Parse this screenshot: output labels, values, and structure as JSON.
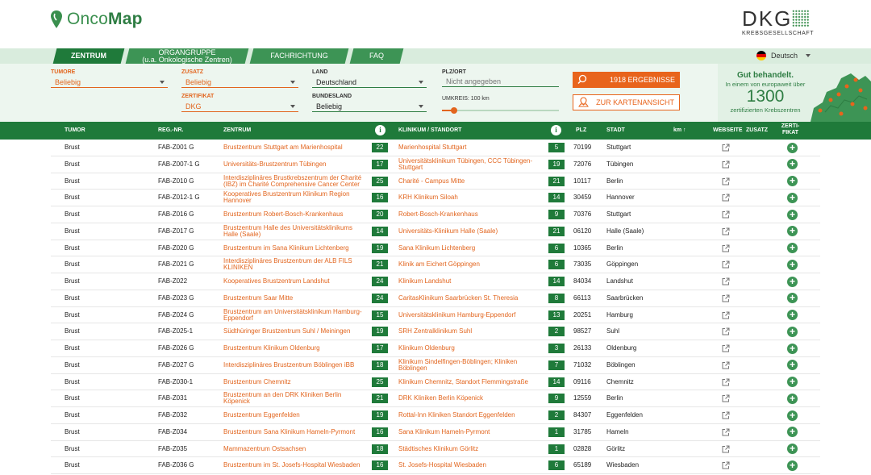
{
  "brand": {
    "logo_prefix": "Onco",
    "logo_suffix": "Map",
    "partner_word": "DKG",
    "partner_sub": "KREBSGESELLSCHAFT"
  },
  "tabs": [
    {
      "label": "ZENTRUM",
      "active": true
    },
    {
      "label_line1": "ORGANGRUPPE",
      "label_line2": "(u.a. Onkologische Zentren)"
    },
    {
      "label": "FACHRICHTUNG"
    },
    {
      "label": "FAQ"
    }
  ],
  "language": "Deutsch",
  "filters": {
    "tumore": {
      "label": "TUMORE",
      "value": "Beliebig"
    },
    "zusatz": {
      "label": "ZUSATZ",
      "value": "Beliebig"
    },
    "zertifikat": {
      "label": "ZERTIFIKAT",
      "value": "DKG"
    },
    "land": {
      "label": "LAND",
      "value": "Deutschland"
    },
    "bundesland": {
      "label": "BUNDESLAND",
      "value": "Beliebig"
    },
    "plz": {
      "label": "PLZ/ORT",
      "placeholder": "Nicht angegeben"
    },
    "umkreis": {
      "label": "UMKREIS: 100 km",
      "fraction": 0.1
    }
  },
  "buttons": {
    "results": "1918 ERGEBNISSE",
    "map": "ZUR KARTENANSICHT"
  },
  "promo": {
    "line1": "Gut behandelt.",
    "line2": "In einem von europaweit über",
    "number": "1300",
    "line3": "zertifizierten Krebszentren"
  },
  "table": {
    "headers": {
      "tumor": "TUMOR",
      "reg": "REG.-NR.",
      "zentrum": "ZENTRUM",
      "klinikum": "KLINIKUM / STANDORT",
      "plz": "PLZ",
      "stadt": "STADT",
      "km": "km ↑",
      "webseite": "WEBSEITE",
      "zusatz": "ZUSATZ",
      "zerti1": "ZERTI-",
      "zerti2": "FIKAT",
      "info": "i"
    },
    "rows": [
      {
        "tumor": "Brust",
        "reg": "FAB-Z001 G",
        "zentrum": "Brustzentrum Stuttgart am Marienhospital",
        "zcount": "22",
        "klinikum": "Marienhospital Stuttgart",
        "kcount": "5",
        "plz": "70199",
        "stadt": "Stuttgart"
      },
      {
        "tumor": "Brust",
        "reg": "FAB-Z007-1 G",
        "zentrum": "Universitäts-Brustzentrum Tübingen",
        "zcount": "17",
        "klinikum": "Universitätsklinikum Tübingen, CCC Tübingen-Stuttgart",
        "kcount": "19",
        "plz": "72076",
        "stadt": "Tübingen"
      },
      {
        "tumor": "Brust",
        "reg": "FAB-Z010 G",
        "zentrum": "Interdisziplinäres Brustkrebszentrum der Charité (IBZ) im Charité Comprehensive Cancer Center",
        "zcount": "25",
        "klinikum": "Charité - Campus Mitte",
        "kcount": "21",
        "plz": "10117",
        "stadt": "Berlin"
      },
      {
        "tumor": "Brust",
        "reg": "FAB-Z012-1 G",
        "zentrum": "Kooperatives Brustzentrum Klinikum Region Hannover",
        "zcount": "16",
        "klinikum": "KRH Klinikum Siloah",
        "kcount": "14",
        "plz": "30459",
        "stadt": "Hannover"
      },
      {
        "tumor": "Brust",
        "reg": "FAB-Z016 G",
        "zentrum": "Brustzentrum Robert-Bosch-Krankenhaus",
        "zcount": "20",
        "klinikum": "Robert-Bosch-Krankenhaus",
        "kcount": "9",
        "plz": "70376",
        "stadt": "Stuttgart"
      },
      {
        "tumor": "Brust",
        "reg": "FAB-Z017 G",
        "zentrum": "Brustzentrum Halle des Universitätsklinikums Halle (Saale)",
        "zcount": "14",
        "klinikum": "Universitäts-Klinikum Halle (Saale)",
        "kcount": "21",
        "plz": "06120",
        "stadt": "Halle (Saale)"
      },
      {
        "tumor": "Brust",
        "reg": "FAB-Z020 G",
        "zentrum": "Brustzentrum im Sana Klinikum Lichtenberg",
        "zcount": "19",
        "klinikum": "Sana Klinikum Lichtenberg",
        "kcount": "6",
        "plz": "10365",
        "stadt": "Berlin"
      },
      {
        "tumor": "Brust",
        "reg": "FAB-Z021 G",
        "zentrum": "Interdisziplinäres Brustzentrum der ALB FILS KLINIKEN",
        "zcount": "21",
        "klinikum": "Klinik am Eichert Göppingen",
        "kcount": "6",
        "plz": "73035",
        "stadt": "Göppingen"
      },
      {
        "tumor": "Brust",
        "reg": "FAB-Z022",
        "zentrum": "Kooperatives Brustzentrum Landshut",
        "zcount": "24",
        "klinikum": "Klinikum Landshut",
        "kcount": "14",
        "plz": "84034",
        "stadt": "Landshut"
      },
      {
        "tumor": "Brust",
        "reg": "FAB-Z023 G",
        "zentrum": "Brustzentrum Saar Mitte",
        "zcount": "24",
        "klinikum": "CaritasKlinikum Saarbrücken St. Theresia",
        "kcount": "8",
        "plz": "66113",
        "stadt": "Saarbrücken"
      },
      {
        "tumor": "Brust",
        "reg": "FAB-Z024 G",
        "zentrum": "Brustzentrum am Universitätsklinikum Hamburg-Eppendorf",
        "zcount": "15",
        "klinikum": "Universitätsklinikum Hamburg-Eppendorf",
        "kcount": "13",
        "plz": "20251",
        "stadt": "Hamburg"
      },
      {
        "tumor": "Brust",
        "reg": "FAB-Z025-1",
        "zentrum": "Südthüringer Brustzentrum Suhl / Meiningen",
        "zcount": "19",
        "klinikum": "SRH Zentralklinikum Suhl",
        "kcount": "2",
        "plz": "98527",
        "stadt": "Suhl"
      },
      {
        "tumor": "Brust",
        "reg": "FAB-Z026 G",
        "zentrum": "Brustzentrum Klinikum Oldenburg",
        "zcount": "17",
        "klinikum": "Klinikum Oldenburg",
        "kcount": "3",
        "plz": "26133",
        "stadt": "Oldenburg"
      },
      {
        "tumor": "Brust",
        "reg": "FAB-Z027 G",
        "zentrum": "Interdisziplinäres Brustzentrum Böblingen iBB",
        "zcount": "18",
        "klinikum": "Klinikum Sindelfingen-Böblingen; Kliniken Böblingen",
        "kcount": "7",
        "plz": "71032",
        "stadt": "Böblingen"
      },
      {
        "tumor": "Brust",
        "reg": "FAB-Z030-1",
        "zentrum": "Brustzentrum Chemnitz",
        "zcount": "25",
        "klinikum": "Klinikum Chemnitz, Standort Flemmingstraße",
        "kcount": "14",
        "plz": "09116",
        "stadt": "Chemnitz"
      },
      {
        "tumor": "Brust",
        "reg": "FAB-Z031",
        "zentrum": "Brustzentrum an den DRK Kliniken Berlin Köpenick",
        "zcount": "21",
        "klinikum": "DRK Kliniken Berlin Köpenick",
        "kcount": "9",
        "plz": "12559",
        "stadt": "Berlin"
      },
      {
        "tumor": "Brust",
        "reg": "FAB-Z032",
        "zentrum": "Brustzentrum Eggenfelden",
        "zcount": "19",
        "klinikum": "Rottal-Inn Kliniken Standort Eggenfelden",
        "kcount": "2",
        "plz": "84307",
        "stadt": "Eggenfelden"
      },
      {
        "tumor": "Brust",
        "reg": "FAB-Z034",
        "zentrum": "Brustzentrum Sana Klinikum Hameln-Pyrmont",
        "zcount": "16",
        "klinikum": "Sana Klinikum Hameln-Pyrmont",
        "kcount": "1",
        "plz": "31785",
        "stadt": "Hameln"
      },
      {
        "tumor": "Brust",
        "reg": "FAB-Z035",
        "zentrum": "Mammazentrum Ostsachsen",
        "zcount": "18",
        "klinikum": "Städtisches Klinikum Görlitz",
        "kcount": "1",
        "plz": "02828",
        "stadt": "Görlitz"
      },
      {
        "tumor": "Brust",
        "reg": "FAB-Z036 G",
        "zentrum": "Brustzentrum im St. Josefs-Hospital Wiesbaden",
        "zcount": "16",
        "klinikum": "St. Josefs-Hospital Wiesbaden",
        "kcount": "6",
        "plz": "65189",
        "stadt": "Wiesbaden"
      }
    ]
  },
  "colors": {
    "green_dark": "#1f7a3a",
    "green": "#3d9455",
    "orange": "#e2651e",
    "panel": "#edf6ef"
  },
  "icons": {
    "logo": "map-pin-icon",
    "search": "search-icon",
    "map": "map-icon",
    "external": "external-link-icon",
    "plus": "plus-icon",
    "info": "info-icon",
    "flag": "german-flag-icon"
  }
}
